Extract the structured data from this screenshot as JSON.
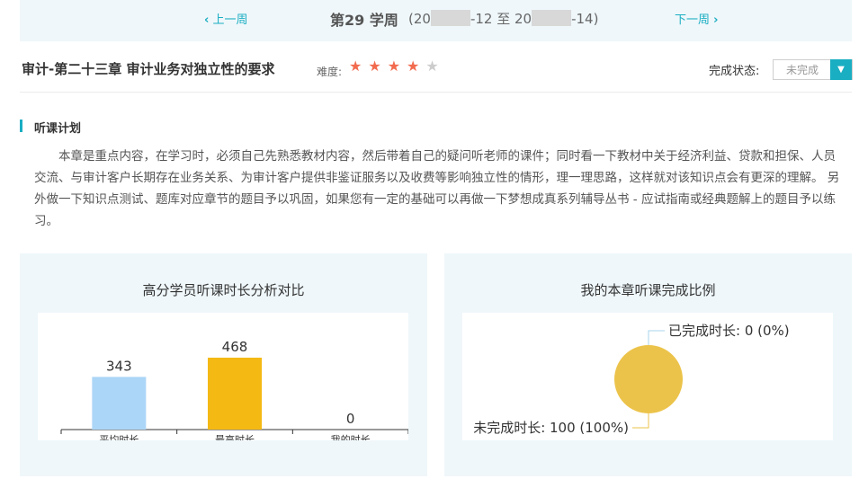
{
  "week": {
    "prev_label": "上一周",
    "next_label": "下一周",
    "title": "第29 学周",
    "range_open": "(20",
    "range_mid": "-12 至 20",
    "range_close": "-14)"
  },
  "chapter": {
    "title": "审计-第二十三章 审计业务对独立性的要求",
    "difficulty_label": "难度:",
    "difficulty_stars": 4,
    "difficulty_max": 5
  },
  "status": {
    "label": "完成状态:",
    "value": "未完成"
  },
  "plan": {
    "title": "听课计划",
    "text": "本章是重点内容，在学习时，必须自己先熟悉教材内容，然后带着自己的疑问听老师的课件；同时看一下教材中关于经济利益、贷款和担保、人员交流、与审计客户长期存在业务关系、为审计客户提供非鉴证服务以及收费等影响独立性的情形，理一理思路，这样就对该知识点会有更深的理解。 另外做一下知识点测试、题库对应章节的题目予以巩固，如果您有一定的基础可以再做一下梦想成真系列辅导丛书 - 应试指南或经典题解上的题目予以练习。"
  },
  "charts": {
    "bar_title": "高分学员听课时长分析对比",
    "pie_title": "我的本章听课完成比例"
  },
  "chart_data": [
    {
      "type": "bar",
      "title": "高分学员听课时长分析对比",
      "categories": [
        "平均时长",
        "最高时长",
        "我的时长"
      ],
      "values": [
        343,
        468,
        0
      ],
      "colors": [
        "#acd6f7",
        "#f5b914",
        "#ffffff"
      ],
      "ylim": [
        0,
        468
      ]
    },
    {
      "type": "pie",
      "title": "我的本章听课完成比例",
      "slices": [
        {
          "label": "已完成时长: 0 (0%)",
          "value": 0
        },
        {
          "label": "未完成时长: 100 (100%)",
          "value": 100
        }
      ],
      "color": "#ecc34a"
    }
  ]
}
